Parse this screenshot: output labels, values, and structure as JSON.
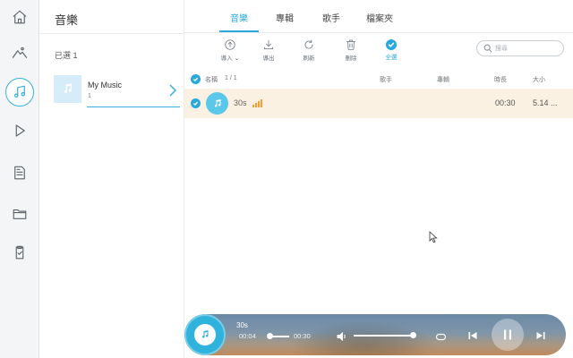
{
  "rail": {
    "items": [
      "home-icon",
      "photos-icon",
      "music-icon",
      "video-icon",
      "document-icon",
      "folder-icon",
      "clipboard-icon"
    ],
    "active": "music-icon",
    "accent": "#2aa8dc"
  },
  "left_panel": {
    "title": "音樂",
    "selected_count": "已選 1",
    "album": {
      "name": "My Music",
      "count": "1"
    }
  },
  "tabs": [
    {
      "label": "音樂",
      "active": true
    },
    {
      "label": "專輯",
      "active": false
    },
    {
      "label": "歌手",
      "active": false
    },
    {
      "label": "檔案夾",
      "active": false
    }
  ],
  "toolbar": {
    "import": "導入",
    "export": "導出",
    "refresh": "刷新",
    "delete": "刪除",
    "select_all": "全選"
  },
  "search": {
    "placeholder": "搜尋"
  },
  "table": {
    "headers": {
      "name": "名稱",
      "count": "1 / 1",
      "artist": "歌手",
      "album": "專輯",
      "duration": "時長",
      "size": "大小"
    },
    "rows": [
      {
        "title": "30s",
        "artist": "",
        "album": "",
        "duration": "00:30",
        "size": "5.14 ...",
        "selected": true,
        "playing": true
      }
    ],
    "row_highlight": "#fbf1e3"
  },
  "player": {
    "title": "30s",
    "current_time": "00:04",
    "total_time": "00:30",
    "progress": 0.13,
    "volume": 0.95,
    "state": "playing"
  }
}
